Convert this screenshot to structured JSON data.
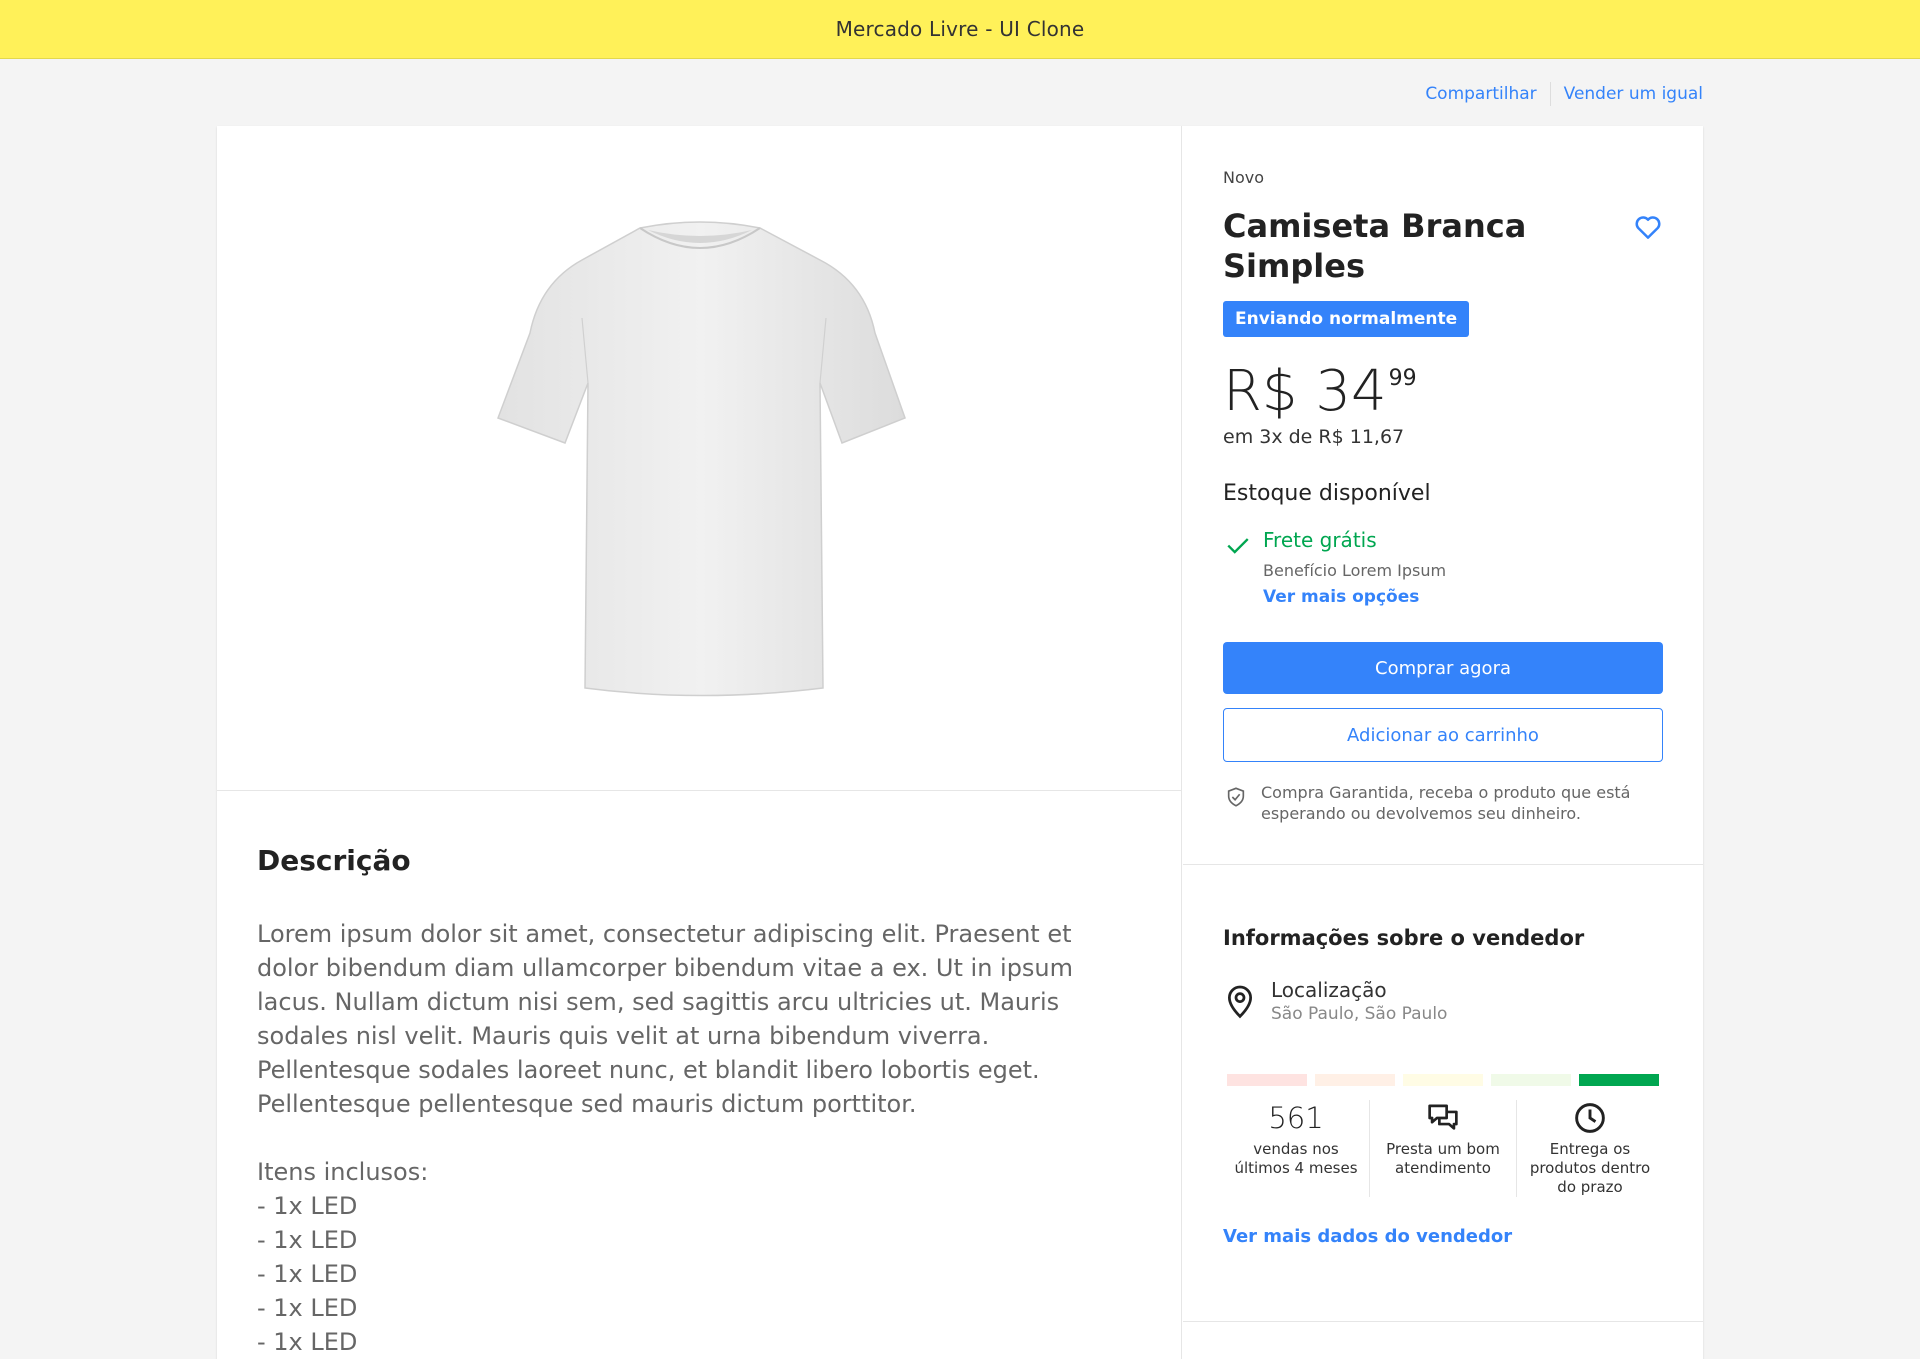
{
  "header": {
    "title": "Mercado Livre - UI Clone"
  },
  "actions": {
    "share": "Compartilhar",
    "sell_same": "Vender um igual"
  },
  "product": {
    "condition": "Novo",
    "title": "Camiseta Branca Simples",
    "shipping_badge": "Enviando normalmente",
    "price_main": "R$ 34",
    "price_cents": "99",
    "installments": "em 3x de R$ 11,67",
    "stock": "Estoque disponível",
    "free_shipping": "Frete grátis",
    "benefit": "Benefício Lorem Ipsum",
    "more_options": "Ver mais opções",
    "buy_now": "Comprar agora",
    "add_to_cart": "Adicionar ao carrinho",
    "guarantee": "Compra Garantida, receba o produto que está esperando ou devolvemos seu dinheiro."
  },
  "description": {
    "title": "Descrição",
    "text": "Lorem ipsum dolor sit amet, consectetur adipiscing elit. Praesent et dolor bibendum diam ullamcorper bibendum vitae a ex. Ut in ipsum lacus. Nullam dictum nisi sem, sed sagittis arcu ultricies ut. Mauris sodales nisl velit. Mauris quis velit at urna bibendum viverra. Pellentesque sodales laoreet nunc, et blandit libero lobortis eget. Pellentesque pellentesque sed mauris dictum porttitor.",
    "items_title": "Itens inclusos:",
    "items": [
      "- 1x LED",
      "- 1x LED",
      "- 1x LED",
      "- 1x LED",
      "- 1x LED"
    ]
  },
  "seller": {
    "title": "Informações sobre o vendedor",
    "location_label": "Localização",
    "location_value": "São Paulo, São Paulo",
    "thermometer_colors": [
      "#fee3e1",
      "#fff0e6",
      "#fffce5",
      "#f0fae8",
      "#00a650"
    ],
    "metrics": {
      "sales_number": "561",
      "sales_text": "vendas nos últimos 4 meses",
      "service_text": "Presta um bom atendimento",
      "delivery_text": "Entrega os produtos dentro do prazo"
    },
    "more_link": "Ver mais dados do vendedor"
  },
  "colors": {
    "brand_yellow": "#fff159",
    "accent_blue": "#3483fa",
    "success_green": "#00a650"
  },
  "icons": [
    "heart-icon",
    "check-icon",
    "shield-icon",
    "location-pin-icon",
    "chat-icon",
    "clock-icon"
  ]
}
